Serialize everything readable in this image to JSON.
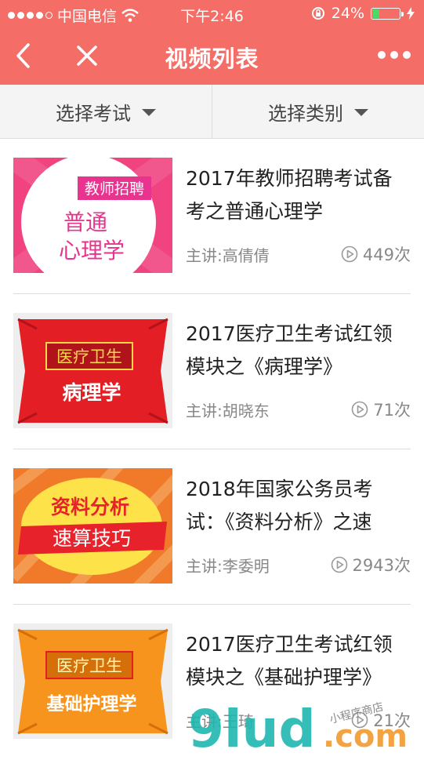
{
  "status_bar": {
    "carrier": "中国电信",
    "time": "下午2:46",
    "battery": "24%",
    "battery_level": 0.24
  },
  "nav": {
    "title": "视频列表"
  },
  "filters": [
    {
      "label": "选择考试"
    },
    {
      "label": "选择类别"
    }
  ],
  "videos": [
    {
      "title": "2017年教师招聘考试备考之普通心理学",
      "lecturer": "主讲:高倩倩",
      "plays": "449次",
      "thumb": {
        "tag": "教师招聘",
        "line1": "普通",
        "line2": "心理学"
      }
    },
    {
      "title": "2017医疗卫生考试红领模块之《病理学》",
      "lecturer": "主讲:胡晓东",
      "plays": "71次",
      "thumb": {
        "tag": "医疗卫生",
        "line1": "病理学"
      }
    },
    {
      "title": "2018年国家公务员考试：《资料分析》之速",
      "lecturer": "主讲:李委明",
      "plays": "2943次",
      "thumb": {
        "line1": "资料分析",
        "line2": "速算技巧"
      }
    },
    {
      "title": "2017医疗卫生考试红领模块之《基础护理学》",
      "lecturer": "主讲:王琦",
      "plays": "21次",
      "thumb": {
        "tag": "医疗卫生",
        "line1": "基础护理学"
      }
    }
  ],
  "watermark": {
    "brand": "9lud",
    "domain": ".com",
    "tagline": "小程序商店"
  },
  "colors": {
    "header": "#f46d67",
    "filter_bg": "#f4f4f4"
  }
}
